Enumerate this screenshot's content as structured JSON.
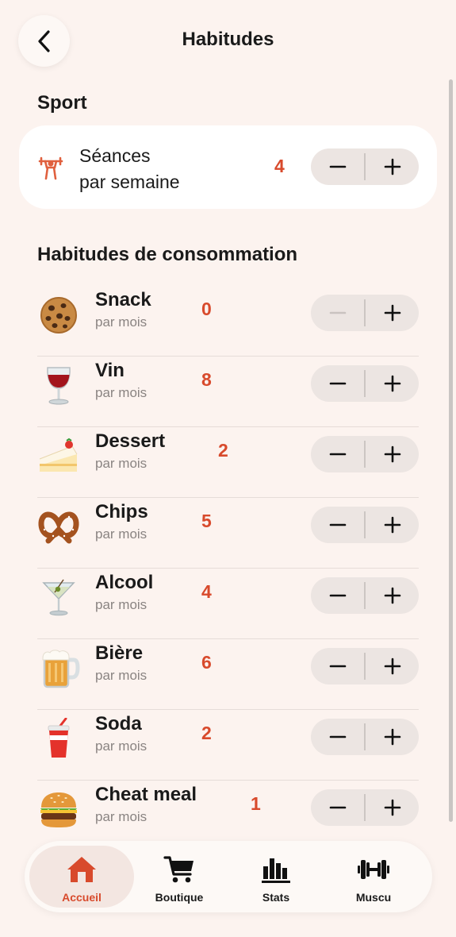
{
  "header": {
    "title": "Habitudes"
  },
  "sport": {
    "section_title": "Sport",
    "label_line1": "Séances",
    "label_line2": "par semaine",
    "value": "4"
  },
  "consumption": {
    "section_title": "Habitudes de consommation",
    "items": [
      {
        "name": "Snack",
        "unit": "par mois",
        "value": "0",
        "icon": "cookie-icon",
        "minus_disabled": true
      },
      {
        "name": "Vin",
        "unit": "par mois",
        "value": "8",
        "icon": "wine-glass-icon"
      },
      {
        "name": "Dessert",
        "unit": "par mois",
        "value": "2",
        "icon": "cake-slice-icon"
      },
      {
        "name": "Chips",
        "unit": "par mois",
        "value": "5",
        "icon": "pretzel-icon"
      },
      {
        "name": "Alcool",
        "unit": "par mois",
        "value": "4",
        "icon": "cocktail-icon"
      },
      {
        "name": "Bière",
        "unit": "par mois",
        "value": "6",
        "icon": "beer-mug-icon"
      },
      {
        "name": "Soda",
        "unit": "par mois",
        "value": "2",
        "icon": "soda-cup-icon"
      },
      {
        "name": "Cheat meal",
        "unit": "par mois",
        "value": "1",
        "icon": "burger-icon"
      }
    ]
  },
  "stepper": {
    "minus": "−",
    "plus": "+"
  },
  "tabbar": {
    "tabs": [
      {
        "label": "Accueil",
        "icon": "home-icon",
        "active": true
      },
      {
        "label": "Boutique",
        "icon": "cart-icon"
      },
      {
        "label": "Stats",
        "icon": "chart-icon"
      },
      {
        "label": "Muscu",
        "icon": "dumbbell-icon"
      }
    ]
  },
  "colors": {
    "accent": "#d84a2c",
    "background": "#fcf3ef",
    "stepper_bg": "#ece5e2"
  }
}
